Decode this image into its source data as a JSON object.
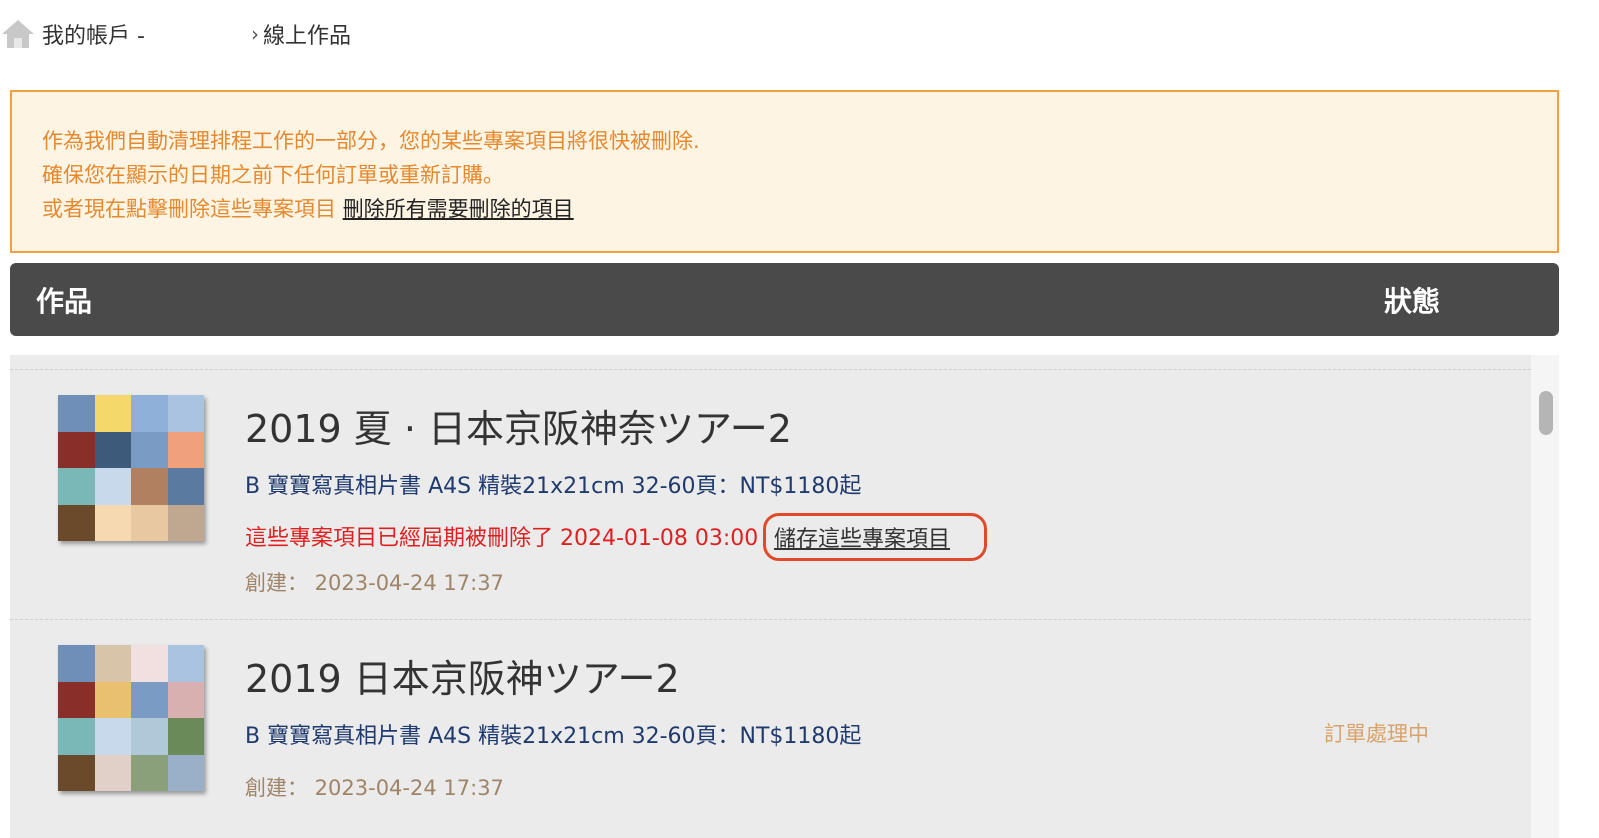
{
  "breadcrumb": {
    "root": "我的帳戶 -",
    "separator": "›",
    "current": "線上作品"
  },
  "notice": {
    "line1": "作為我們自動清理排程工作的一部分，您的某些專案項目將很快被刪除.",
    "line2": "確保您在顯示的日期之前下任何訂單或重新訂購。",
    "line3_text": "或者現在點擊刪除這些專案項目 ",
    "line3_link": "刪除所有需要刪除的項目"
  },
  "table_header": {
    "works": "作品",
    "status": "狀態"
  },
  "projects": [
    {
      "title": "2019 夏 · 日本京阪神奈ツアー2",
      "product": "B 寶寶寫真相片書 A4S 精裝21x21cm 32-60頁：NT$1180起",
      "expire_text": "這些專案項目已經屆期被刪除了 2024-01-08 03:00",
      "save_link": "儲存這些專案項目",
      "created": "創建： 2023-04-24 17:37",
      "status": ""
    },
    {
      "title": "2019 日本京阪神ツアー2",
      "product": "B 寶寶寫真相片書 A4S 精裝21x21cm 32-60頁：NT$1180起",
      "created": "創建： 2023-04-24 17:37",
      "status": "訂單處理中"
    }
  ],
  "colors": {
    "notice_text": "#e5892e",
    "notice_border": "#f0a040",
    "header_bg": "#4a4a4a",
    "expire_red": "#e02020",
    "status_orange": "#d9a26a",
    "product_blue": "#1f3a6e"
  }
}
